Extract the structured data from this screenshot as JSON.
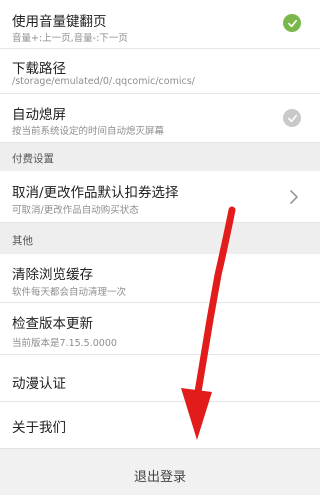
{
  "settings": {
    "volume_page": {
      "title": "使用音量键翻页",
      "subtitle": "音量+:上一页,音量-:下一页",
      "toggle_color": "#7ab84a"
    },
    "download_path": {
      "title": "下载路径",
      "subtitle": "/storage/emulated/0/.qqcomic/comics/"
    },
    "auto_screen_off": {
      "title": "自动熄屏",
      "subtitle": "按当前系统设定的时间自动熄灭屏幕",
      "toggle_color": "#c9c9c9"
    }
  },
  "sections": {
    "paid": "付费设置",
    "other": "其他"
  },
  "paid": {
    "auto_buy": {
      "title": "取消/更改作品默认扣券选择",
      "subtitle": "可取消/更改作品自动购买状态"
    }
  },
  "other": {
    "clear_cache": {
      "title": "清除浏览缓存",
      "subtitle": "软件每天都会自动清理一次"
    },
    "check_update": {
      "title": "检查版本更新",
      "subtitle": "当前版本是7.15.5.0000"
    },
    "anime_cert": {
      "title": "动漫认证"
    },
    "about": {
      "title": "关于我们"
    }
  },
  "footer": {
    "logout_label": "退出登录"
  },
  "overlay": {
    "arrow_color": "#e21b1b"
  }
}
